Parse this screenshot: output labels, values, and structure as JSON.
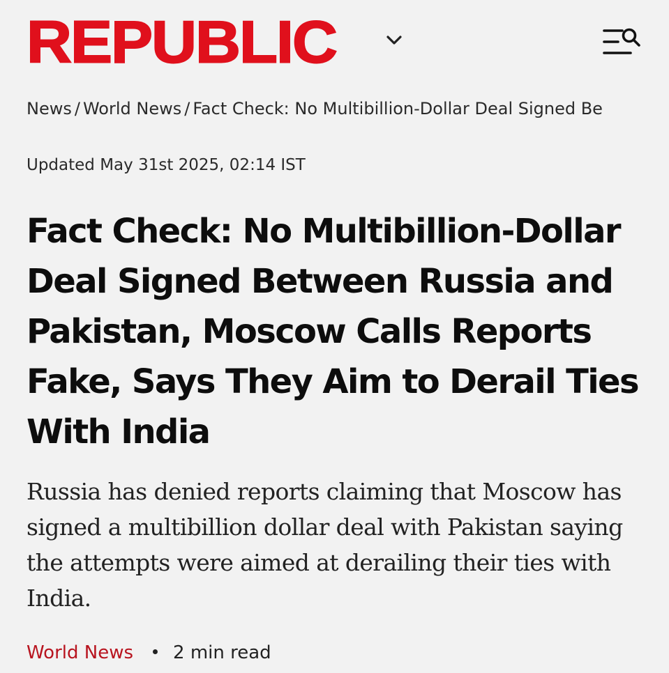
{
  "header": {
    "logo": "REPUBLIC",
    "dropdown_icon": "chevron-down-icon",
    "menu_icon": "menu-search-icon",
    "brand_color": "#e0101c"
  },
  "breadcrumb": {
    "items": [
      "News",
      "World News",
      "Fact Check: No Multibillion-Dollar Deal Signed Be"
    ],
    "separator": "/"
  },
  "article": {
    "updated": "Updated May 31st 2025, 02:14 IST",
    "headline": "Fact Check: No Multibillion-Dollar Deal Signed Between Russia and Pakistan, Moscow Calls Reports Fake, Says They Aim to Derail Ties With India",
    "summary": "Russia has denied reports claiming that Moscow has signed a multibillion dollar deal with Pakistan saying the attempts were aimed at derailing their ties with India.",
    "category": "World News",
    "read_time": "2 min read",
    "category_color": "#b8141f"
  }
}
